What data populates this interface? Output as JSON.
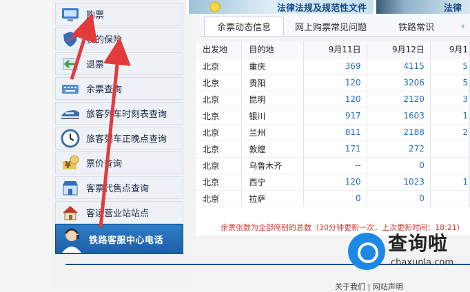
{
  "banner": {
    "title_left": "法律法规及规范性文件",
    "title_right": "法律法"
  },
  "sidebar": {
    "items": [
      {
        "label": "购票",
        "icon": "computer-ticket-icon"
      },
      {
        "label": "我的保险",
        "icon": "shield-icon"
      },
      {
        "label": "退票",
        "icon": "return-arrow-icon"
      },
      {
        "label": "余票查询",
        "icon": "keyboard-icon"
      },
      {
        "label": "旅客列车时刻表查询",
        "icon": "train-icon"
      },
      {
        "label": "旅客列车正晚点查询",
        "icon": "clock-icon"
      },
      {
        "label": "票价查询",
        "icon": "yen-icon"
      },
      {
        "label": "客票代售点查询",
        "icon": "shop-icon"
      },
      {
        "label": "客运营业站站点",
        "icon": "house-icon"
      }
    ],
    "hotline": "铁路客服中心电话"
  },
  "tabs": [
    "余票动态信息",
    "网上购票常见问题",
    "铁路常识"
  ],
  "table": {
    "headers": [
      "出发地",
      "目的地",
      "9月11日",
      "9月12日",
      "9月1"
    ],
    "rows": [
      [
        "北京",
        "重庆",
        "369",
        "4115",
        "5"
      ],
      [
        "北京",
        "贵阳",
        "120",
        "3206",
        "5"
      ],
      [
        "北京",
        "昆明",
        "120",
        "2120",
        "3"
      ],
      [
        "北京",
        "银川",
        "917",
        "1603",
        "1"
      ],
      [
        "北京",
        "兰州",
        "811",
        "2188",
        "2"
      ],
      [
        "北京",
        "敦煌",
        "171",
        "272",
        ""
      ],
      [
        "北京",
        "乌鲁木齐",
        "--",
        "0",
        ""
      ],
      [
        "北京",
        "西宁",
        "120",
        "1023",
        "1"
      ],
      [
        "北京",
        "拉萨",
        "0",
        "0",
        ""
      ]
    ],
    "note": "余票张数为全部席别的总数（30分钟更新一次，上次更新时间：18:21）"
  },
  "footer": {
    "text": "关于我们 | 网站声明"
  },
  "watermark": {
    "title": "查询啦",
    "url": "chaxunla.com"
  },
  "colors": {
    "accent": "#1f6fbf",
    "arrow": "#e23b3b",
    "hotline_bg": "#2d7ec7",
    "note": "#d23c32"
  }
}
